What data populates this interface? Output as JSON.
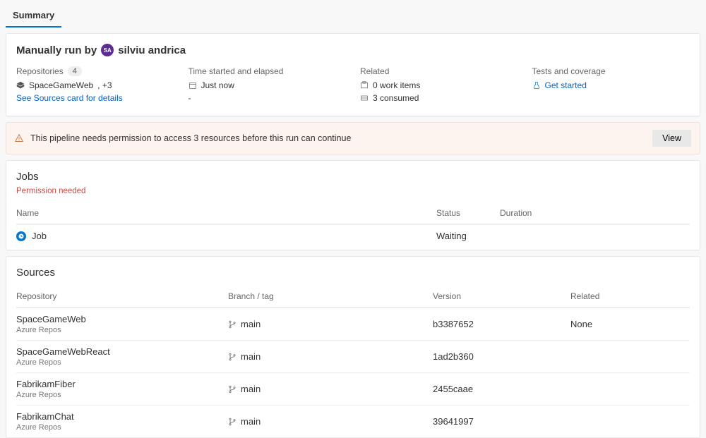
{
  "tab": {
    "label": "Summary"
  },
  "run": {
    "prefix": "Manually run by",
    "initials": "SA",
    "user": "silviu andrica"
  },
  "repoCol": {
    "label": "Repositories",
    "count": "4",
    "primary": "SpaceGameWeb",
    "more": ", +3",
    "seeSources": "See Sources card for details"
  },
  "timeCol": {
    "label": "Time started and elapsed",
    "started": "Just now",
    "elapsed": "-"
  },
  "relatedCol": {
    "label": "Related",
    "workItems": "0 work items",
    "consumed": "3 consumed"
  },
  "testsCol": {
    "label": "Tests and coverage",
    "action": "Get started"
  },
  "permission": {
    "text": "This pipeline needs permission to access 3 resources before this run can continue",
    "view": "View"
  },
  "jobs": {
    "title": "Jobs",
    "warn": "Permission needed",
    "head": {
      "name": "Name",
      "status": "Status",
      "duration": "Duration"
    },
    "row": {
      "name": "Job",
      "status": "Waiting"
    }
  },
  "sources": {
    "title": "Sources",
    "head": {
      "repo": "Repository",
      "branch": "Branch / tag",
      "version": "Version",
      "related": "Related"
    },
    "rows": [
      {
        "repo": "SpaceGameWeb",
        "provider": "Azure Repos",
        "branch": "main",
        "version": "b3387652",
        "related": "None"
      },
      {
        "repo": "SpaceGameWebReact",
        "provider": "Azure Repos",
        "branch": "main",
        "version": "1ad2b360",
        "related": ""
      },
      {
        "repo": "FabrikamFiber",
        "provider": "Azure Repos",
        "branch": "main",
        "version": "2455caae",
        "related": ""
      },
      {
        "repo": "FabrikamChat",
        "provider": "Azure Repos",
        "branch": "main",
        "version": "39641997",
        "related": ""
      }
    ]
  }
}
